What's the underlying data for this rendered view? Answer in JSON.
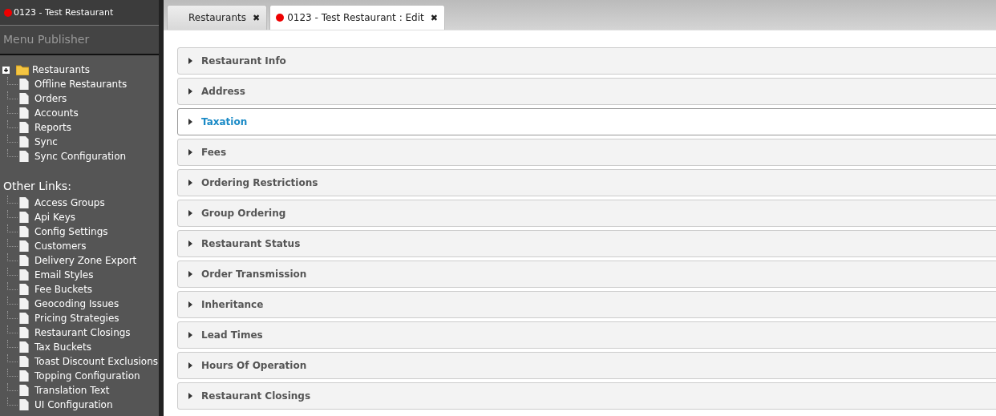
{
  "sidebar": {
    "restaurant": "0123 - Test Restaurant",
    "color": "#ee0000",
    "app_title": "Menu Publisher",
    "tree": [
      {
        "label": "Restaurants",
        "kind": "folder",
        "expanded": false
      },
      {
        "label": "Offline Restaurants",
        "kind": "page"
      },
      {
        "label": "Orders",
        "kind": "page"
      },
      {
        "label": "Accounts",
        "kind": "page"
      },
      {
        "label": "Reports",
        "kind": "page"
      },
      {
        "label": "Sync",
        "kind": "page"
      },
      {
        "label": "Sync Configuration",
        "kind": "page"
      }
    ],
    "other_links_title": "Other Links:",
    "other_links": [
      "Access Groups",
      "Api Keys",
      "Config Settings",
      "Customers",
      "Delivery Zone Export",
      "Email Styles",
      "Fee Buckets",
      "Geocoding Issues",
      "Pricing Strategies",
      "Restaurant Closings",
      "Tax Buckets",
      "Toast Discount Exclusions",
      "Topping Configuration",
      "Translation Text",
      "UI Configuration"
    ]
  },
  "tabs": [
    {
      "label": "Restaurants",
      "selected": false,
      "close": "✖"
    },
    {
      "label": "0123 - Test Restaurant : Edit",
      "selected": true,
      "color": "#ee0000",
      "close": "✖"
    }
  ],
  "sections": [
    {
      "title": "Restaurant Info",
      "highlighted": false
    },
    {
      "title": "Address",
      "highlighted": false
    },
    {
      "title": "Taxation",
      "highlighted": true
    },
    {
      "title": "Fees",
      "highlighted": false
    },
    {
      "title": "Ordering Restrictions",
      "highlighted": false
    },
    {
      "title": "Group Ordering",
      "highlighted": false
    },
    {
      "title": "Restaurant Status",
      "highlighted": false
    },
    {
      "title": "Order Transmission",
      "highlighted": false
    },
    {
      "title": "Inheritance",
      "highlighted": false
    },
    {
      "title": "Lead Times",
      "highlighted": false
    },
    {
      "title": "Hours Of Operation",
      "highlighted": false
    },
    {
      "title": "Restaurant Closings",
      "highlighted": false
    }
  ]
}
